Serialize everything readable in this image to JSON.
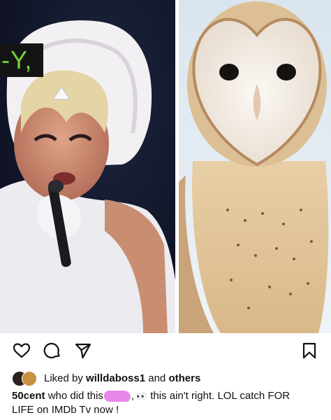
{
  "image_overlay": {
    "text": "-Y,"
  },
  "actions": {
    "like": "heart-icon",
    "comment": "comment-icon",
    "share": "send-icon",
    "save": "bookmark-icon"
  },
  "likes": {
    "prefix": "Liked by ",
    "user": "willdaboss1",
    "middle": " and ",
    "others": "others"
  },
  "caption": {
    "username": "50cent",
    "part1": " who did this",
    "part2": ",",
    "part3": " this ain't right. LOL catch FOR",
    "part4": "LIFE on IMDb Tv now !",
    "eyes_emoji": "👀"
  },
  "colors": {
    "overlay_text": "#6fd13b",
    "scribble": "#e887e8"
  }
}
